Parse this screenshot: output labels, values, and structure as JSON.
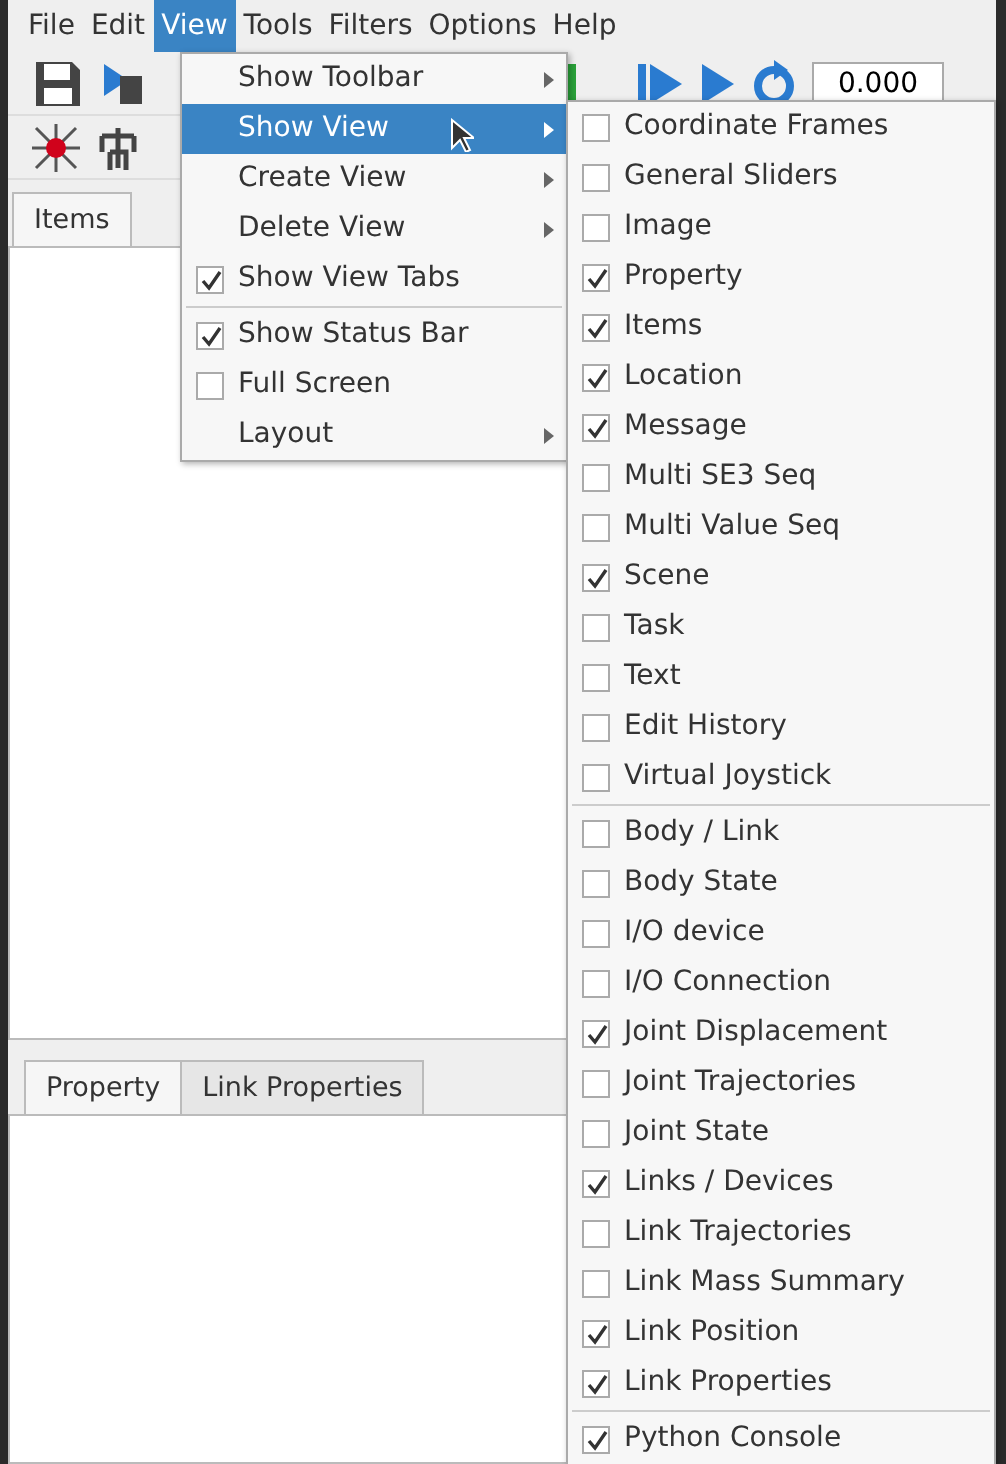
{
  "menu_bar": [
    {
      "label": "File",
      "selected": false
    },
    {
      "label": "Edit",
      "selected": false
    },
    {
      "label": "View",
      "selected": true
    },
    {
      "label": "Tools",
      "selected": false
    },
    {
      "label": "Filters",
      "selected": false
    },
    {
      "label": "Options",
      "selected": false
    },
    {
      "label": "Help",
      "selected": false
    }
  ],
  "toolbar": {
    "time_field": "0.000"
  },
  "top_panel": {
    "tabs": [
      {
        "label": "Items",
        "selected": true
      }
    ]
  },
  "bottom_panel": {
    "tabs": [
      {
        "label": "Property",
        "selected": true
      },
      {
        "label": "Link Properties",
        "selected": false
      }
    ]
  },
  "view_menu": {
    "items": [
      {
        "kind": "submenu",
        "label": "Show Toolbar",
        "selected": false
      },
      {
        "kind": "submenu",
        "label": "Show View",
        "selected": true
      },
      {
        "kind": "submenu",
        "label": "Create View",
        "selected": false
      },
      {
        "kind": "submenu",
        "label": "Delete View",
        "selected": false
      },
      {
        "kind": "check",
        "label": "Show View Tabs",
        "checked": true,
        "selected": false
      },
      {
        "kind": "separator"
      },
      {
        "kind": "check",
        "label": "Show Status Bar",
        "checked": true,
        "selected": false
      },
      {
        "kind": "check",
        "label": "Full Screen",
        "checked": false,
        "selected": false
      },
      {
        "kind": "submenu",
        "label": "Layout",
        "selected": false
      }
    ]
  },
  "show_view_menu": {
    "items": [
      {
        "kind": "check",
        "label": "Coordinate Frames",
        "checked": false
      },
      {
        "kind": "check",
        "label": "General Sliders",
        "checked": false
      },
      {
        "kind": "check",
        "label": "Image",
        "checked": false
      },
      {
        "kind": "check",
        "label": "Property",
        "checked": true
      },
      {
        "kind": "check",
        "label": "Items",
        "checked": true
      },
      {
        "kind": "check",
        "label": "Location",
        "checked": true
      },
      {
        "kind": "check",
        "label": "Message",
        "checked": true
      },
      {
        "kind": "check",
        "label": "Multi SE3 Seq",
        "checked": false
      },
      {
        "kind": "check",
        "label": "Multi Value Seq",
        "checked": false
      },
      {
        "kind": "check",
        "label": "Scene",
        "checked": true
      },
      {
        "kind": "check",
        "label": "Task",
        "checked": false
      },
      {
        "kind": "check",
        "label": "Text",
        "checked": false
      },
      {
        "kind": "check",
        "label": "Edit History",
        "checked": false
      },
      {
        "kind": "check",
        "label": "Virtual Joystick",
        "checked": false
      },
      {
        "kind": "separator"
      },
      {
        "kind": "check",
        "label": "Body / Link",
        "checked": false
      },
      {
        "kind": "check",
        "label": "Body State",
        "checked": false
      },
      {
        "kind": "check",
        "label": "I/O device",
        "checked": false
      },
      {
        "kind": "check",
        "label": "I/O Connection",
        "checked": false
      },
      {
        "kind": "check",
        "label": "Joint Displacement",
        "checked": true
      },
      {
        "kind": "check",
        "label": "Joint Trajectories",
        "checked": false
      },
      {
        "kind": "check",
        "label": "Joint State",
        "checked": false
      },
      {
        "kind": "check",
        "label": "Links / Devices",
        "checked": true
      },
      {
        "kind": "check",
        "label": "Link Trajectories",
        "checked": false
      },
      {
        "kind": "check",
        "label": "Link Mass Summary",
        "checked": false
      },
      {
        "kind": "check",
        "label": "Link Position",
        "checked": true
      },
      {
        "kind": "check",
        "label": "Link Properties",
        "checked": true
      },
      {
        "kind": "separator"
      },
      {
        "kind": "check",
        "label": "Python Console",
        "checked": true
      }
    ]
  }
}
